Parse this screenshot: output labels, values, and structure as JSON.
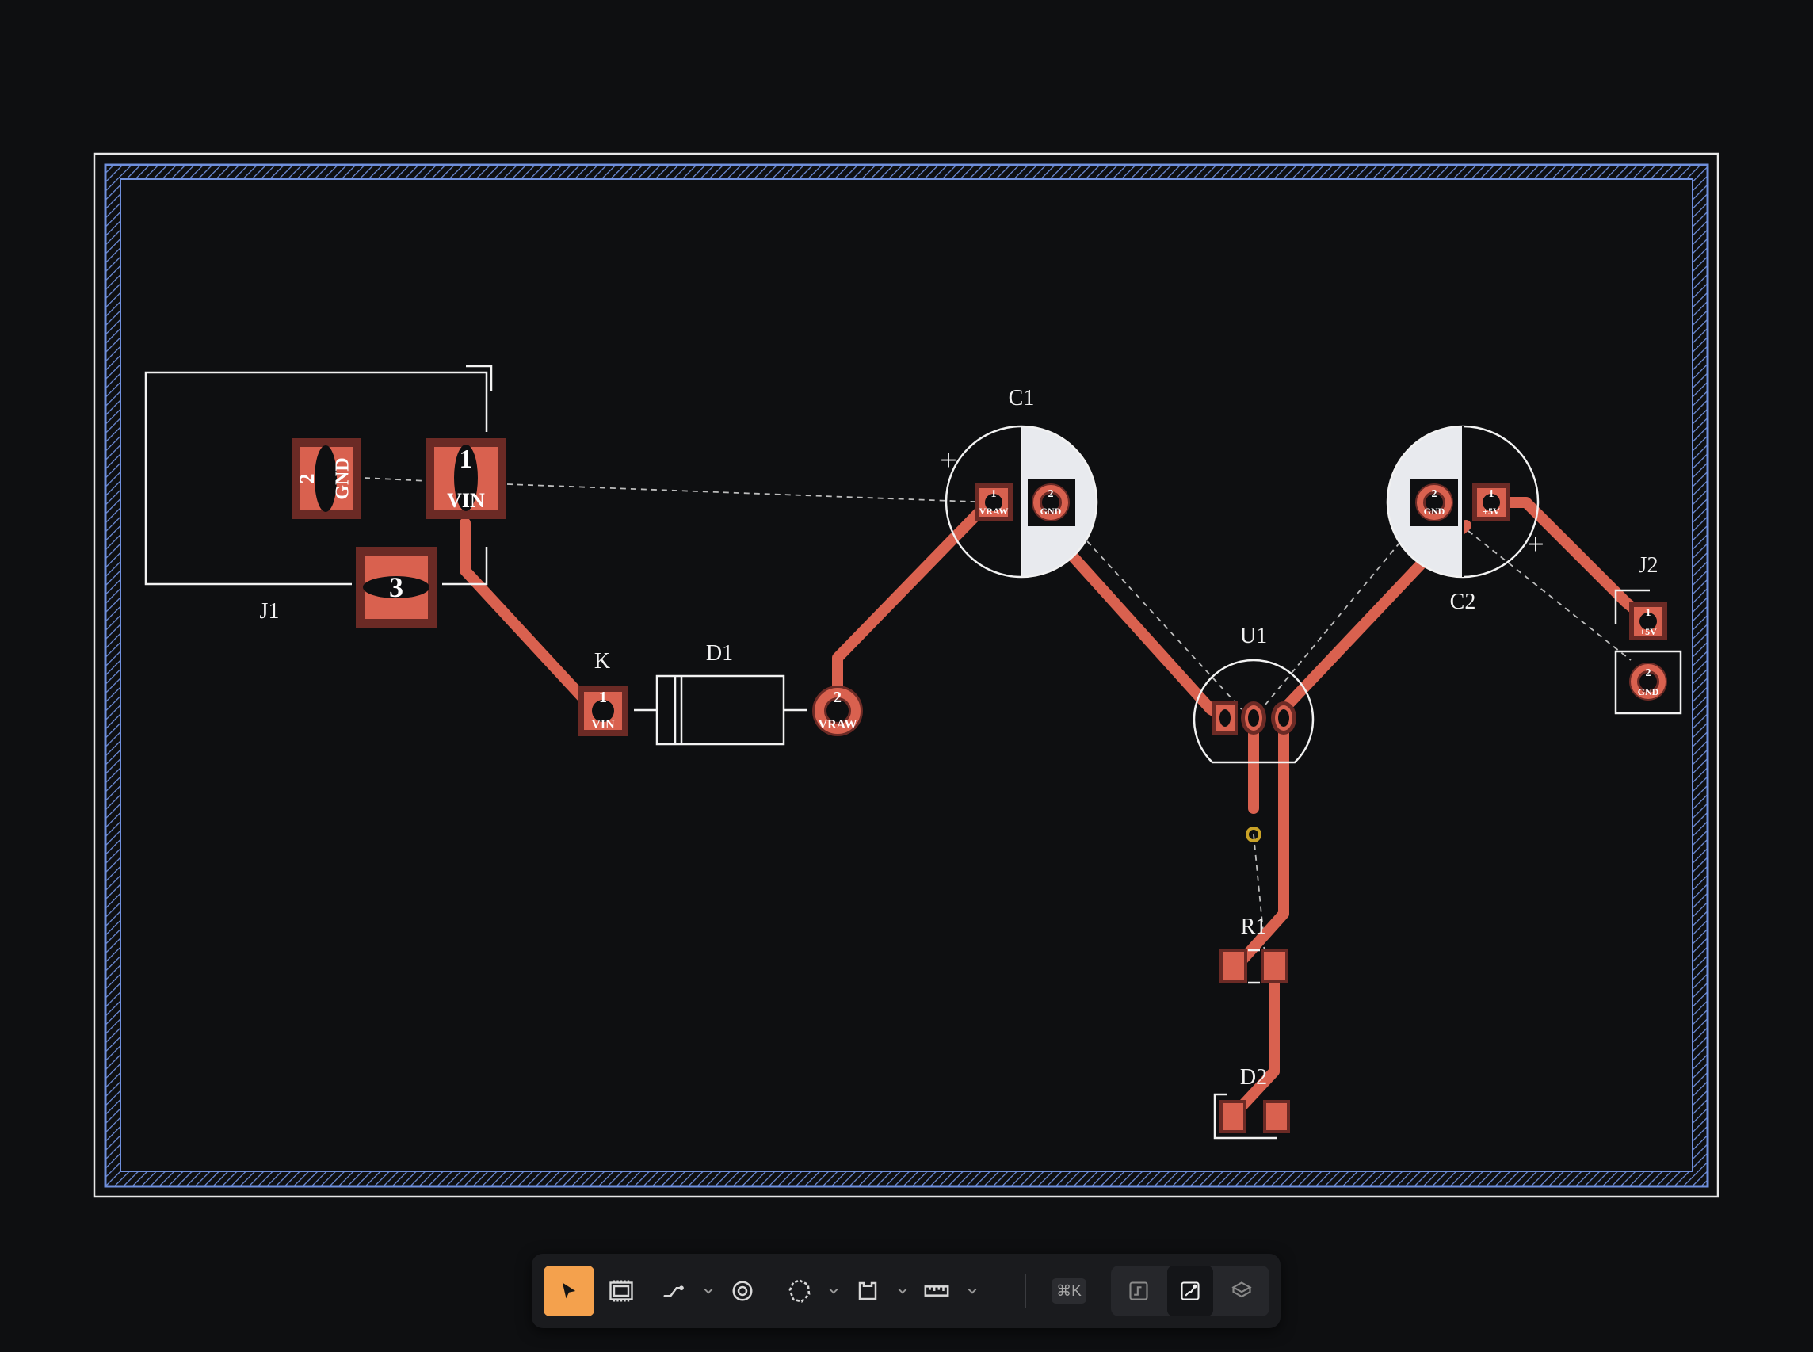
{
  "board": {
    "background": "#0e0f11",
    "copper_color": "#d9614f",
    "copper_dark": "#6b2a25",
    "silk_color": "#f2f2f2",
    "edge_color": "#6f8fdc",
    "ratsnest_color": "#bdbdbd",
    "via_color": "#c9a227"
  },
  "components": {
    "j1": {
      "ref": "J1",
      "pad1_num": "1",
      "pad1_net": "VIN",
      "pad2_num": "2",
      "pad2_net": "GND",
      "pad3_num": "3"
    },
    "d1": {
      "ref": "D1",
      "cathode_label": "K",
      "pad1_num": "1",
      "pad1_net": "VIN",
      "pad2_num": "2",
      "pad2_net": "VRAW"
    },
    "c1": {
      "ref": "C1",
      "polarity": "+",
      "pad1_num": "1",
      "pad1_net": "VRAW",
      "pad2_num": "2",
      "pad2_net": "GND"
    },
    "c2": {
      "ref": "C2",
      "polarity": "+",
      "pad1_num": "1",
      "pad1_net": "+5V",
      "pad2_num": "2",
      "pad2_net": "GND"
    },
    "u1": {
      "ref": "U1"
    },
    "j2": {
      "ref": "J2",
      "pad1_num": "1",
      "pad1_net": "+5V",
      "pad2_num": "2",
      "pad2_net": "GND"
    },
    "r1": {
      "ref": "R1"
    },
    "d2": {
      "ref": "D2"
    }
  },
  "toolbar": {
    "select_tool": "select-tool",
    "footprint_tool": "footprint-tool",
    "route_tool": "route-tool",
    "via_tool": "via-tool",
    "zone_tool": "zone-tool",
    "board_outline_tool": "board-outline-tool",
    "measure_tool": "measure-tool",
    "shortcut": "⌘K",
    "view_schematic": "schematic-view",
    "view_pcb": "pcb-view",
    "view_3d": "3d-view",
    "active_tool": "select-tool",
    "active_view": "pcb-view",
    "accent": "#f4a14d"
  }
}
